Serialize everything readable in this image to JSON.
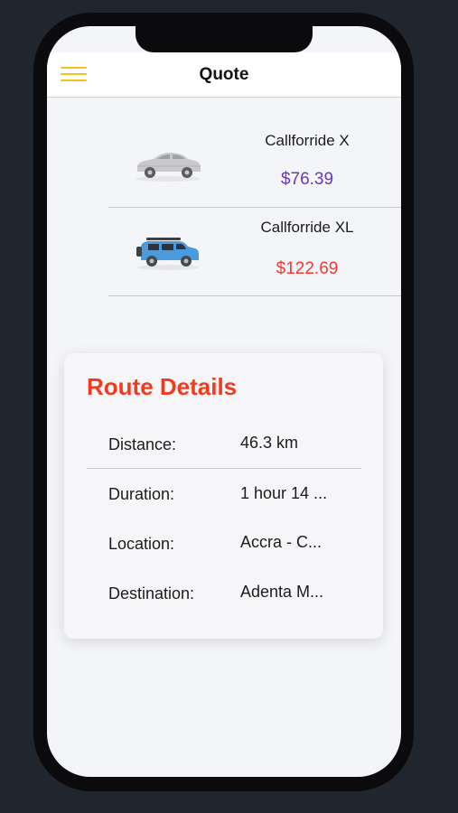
{
  "header": {
    "title": "Quote",
    "menu_icon": "hamburger-icon"
  },
  "rides": [
    {
      "name": "Callforride X",
      "price": "$76.39",
      "price_color": "#6a38b0",
      "car_color": "#c9c9cc",
      "icon": "sedan-car-icon"
    },
    {
      "name": "Callforride XL",
      "price": "$122.69",
      "price_color": "#f23a30",
      "car_color": "#4a9bdd",
      "icon": "suv-car-icon"
    }
  ],
  "route": {
    "title": "Route Details",
    "title_color": "#f23a1f",
    "details": [
      {
        "label": "Distance:",
        "value": "46.3 km"
      },
      {
        "label": "Duration:",
        "value": "1 hour 14 ..."
      },
      {
        "label": "Location:",
        "value": "Accra - C..."
      },
      {
        "label": "Destination:",
        "value": "Adenta M..."
      }
    ]
  },
  "colors": {
    "accent": "#f4c31a",
    "background": "#21252d",
    "screen": "#f4f5f8"
  }
}
